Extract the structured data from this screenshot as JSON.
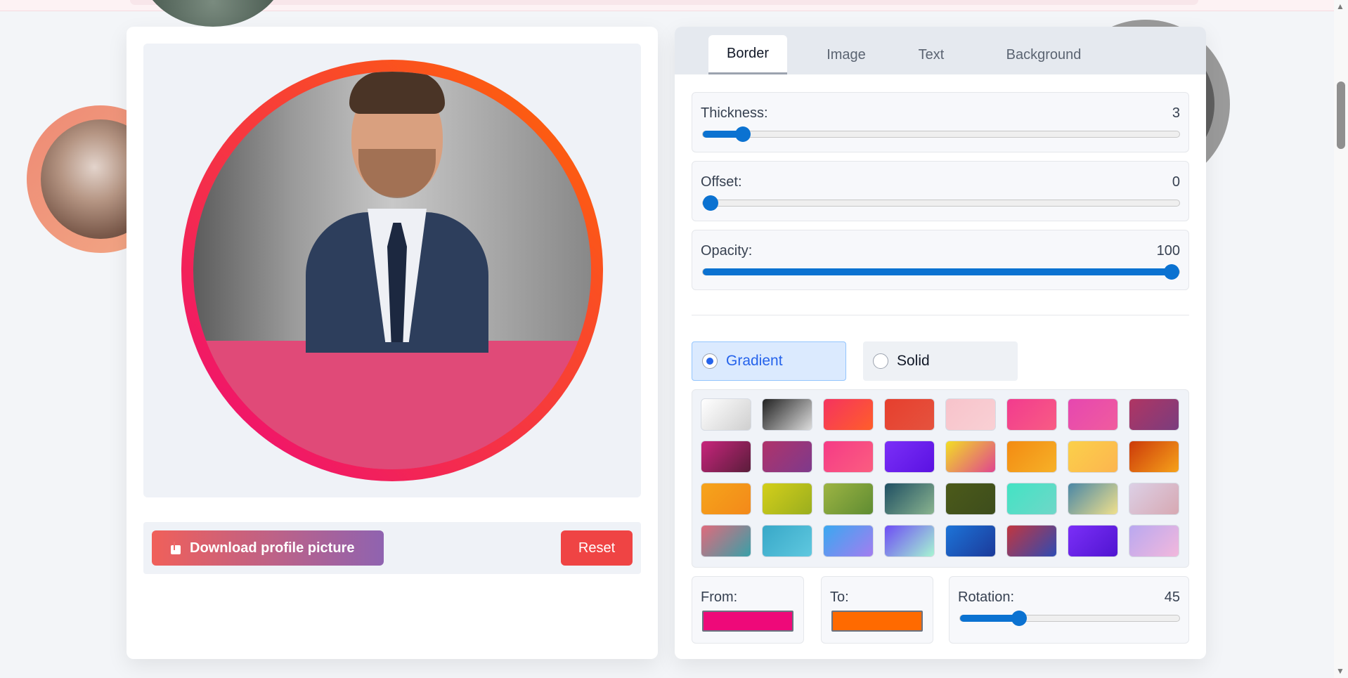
{
  "preview": {
    "border_gradient_from": "#ee0979",
    "border_gradient_to": "#ff6a00",
    "photo_background": "#e04a78"
  },
  "actions": {
    "download_label": "Download profile picture",
    "reset_label": "Reset"
  },
  "tabs": [
    {
      "label": "Border",
      "active": true
    },
    {
      "label": "Image",
      "active": false
    },
    {
      "label": "Text",
      "active": false
    },
    {
      "label": "Background",
      "active": false
    }
  ],
  "sliders": [
    {
      "label": "Thickness:",
      "value": "3",
      "fraction": 0.07
    },
    {
      "label": "Offset:",
      "value": "0",
      "fraction": 0.0
    },
    {
      "label": "Opacity:",
      "value": "100",
      "fraction": 1.0
    }
  ],
  "mode": {
    "gradient_label": "Gradient",
    "solid_label": "Solid",
    "selected": "gradient"
  },
  "swatches": [
    [
      "linear-gradient(135deg,#ffffff,#cfcfcf)",
      "linear-gradient(135deg,#222,#ddd)",
      "linear-gradient(135deg,#f5335f,#ff5e2a)",
      "linear-gradient(135deg,#e63f2e,#e5533e)",
      "linear-gradient(135deg,#f7c3cb,#f9d0d4)",
      "linear-gradient(135deg,#f23b8e,#f85c84)",
      "linear-gradient(135deg,#e647b0,#f05c9e)",
      "linear-gradient(135deg,#b03563,#7a3d7e)"
    ],
    [
      "linear-gradient(135deg,#c8257c,#5a1d3b)",
      "linear-gradient(135deg,#b0336a,#7e3a8c)",
      "linear-gradient(135deg,#f53b86,#fb5d80)",
      "linear-gradient(135deg,#7b2ff7,#5a12e2)",
      "linear-gradient(135deg,#f2de25,#e0458f)",
      "linear-gradient(135deg,#f38b12,#f6b128)",
      "linear-gradient(135deg,#fbd04a,#fcb54f)",
      "linear-gradient(135deg,#cc3a0a,#f6a21a)"
    ],
    [
      "linear-gradient(135deg,#f6a41b,#f3891a)",
      "linear-gradient(135deg,#d4cf1a,#9aae1e)",
      "linear-gradient(135deg,#9db443,#5f8c32)",
      "linear-gradient(135deg,#1f4f63,#8ab48f)",
      "linear-gradient(135deg,#4c5a1a,#3d4d1c)",
      "linear-gradient(135deg,#43e3c4,#6fd7c8)",
      "linear-gradient(135deg,#4a87a6,#f0e08c)",
      "linear-gradient(135deg,#dcd0e6,#d7a8b2)"
    ],
    [
      "linear-gradient(135deg,#e06a7c,#38a0a8)",
      "linear-gradient(135deg,#38a8c8,#5fc8df)",
      "linear-gradient(135deg,#3aa8f0,#a37df0)",
      "linear-gradient(135deg,#6d4cf5,#a6f5d2)",
      "linear-gradient(135deg,#1d74d8,#1b3a9a)",
      "linear-gradient(135deg,#c2363f,#2e4bb3)",
      "linear-gradient(135deg,#7b2ff7,#5015d1)",
      "linear-gradient(135deg,#b9a8f0,#f2b8dc)"
    ]
  ],
  "gradient_controls": {
    "from_label": "From:",
    "to_label": "To:",
    "from_color": "#ee0979",
    "to_color": "#ff6a00",
    "rotation_label": "Rotation:",
    "rotation_value": "45",
    "rotation_fraction": 0.25
  }
}
